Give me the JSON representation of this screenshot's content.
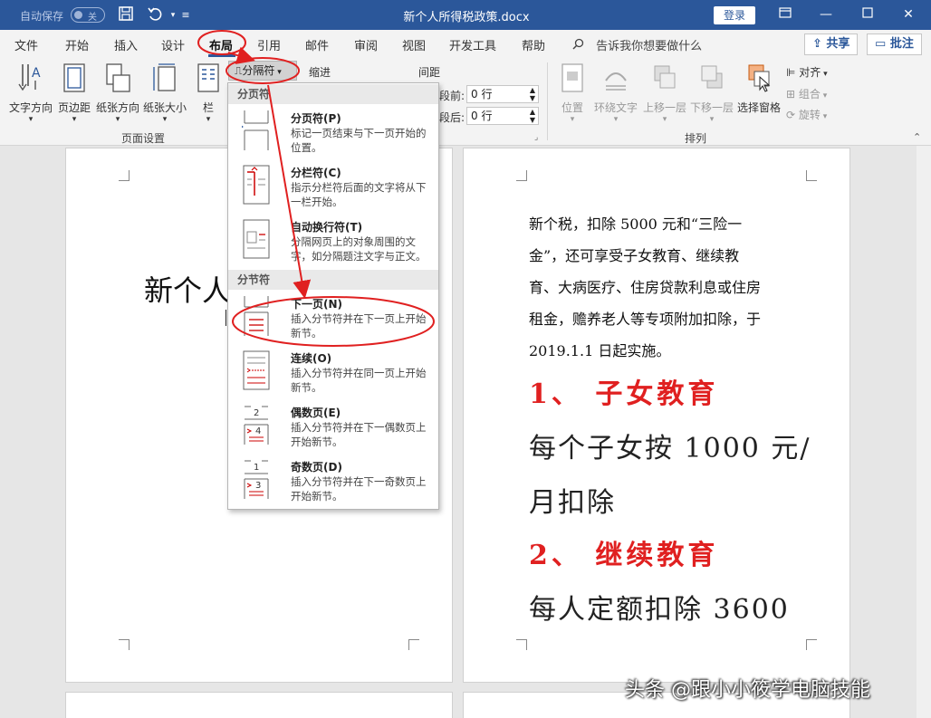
{
  "titlebar": {
    "autosave_label": "自动保存",
    "autosave_state": "关",
    "doc_title": "新个人所得税政策.docx",
    "login_label": "登录"
  },
  "tabs": [
    {
      "label": "文件",
      "active": false
    },
    {
      "label": "开始",
      "active": false
    },
    {
      "label": "插入",
      "active": false
    },
    {
      "label": "设计",
      "active": false
    },
    {
      "label": "布局",
      "active": true
    },
    {
      "label": "引用",
      "active": false
    },
    {
      "label": "邮件",
      "active": false
    },
    {
      "label": "审阅",
      "active": false
    },
    {
      "label": "视图",
      "active": false
    },
    {
      "label": "开发工具",
      "active": false
    },
    {
      "label": "帮助",
      "active": false
    }
  ],
  "tell_me": "告诉我你想要做什么",
  "share_label": "共享",
  "comment_label": "批注",
  "ribbon": {
    "page_setup": {
      "text_direction": "文字方向",
      "margins": "页边距",
      "orientation": "纸张方向",
      "size": "纸张大小",
      "columns": "栏",
      "breaks": "分隔符",
      "group_label": "页面设置"
    },
    "indent_label": "缩进",
    "spacing_label": "间距",
    "spacing_before_label": "段前:",
    "spacing_before_value": "0 行",
    "spacing_after_label": "段后:",
    "spacing_after_value": "0 行",
    "arrange": {
      "position": "位置",
      "wrap_text": "环绕文字",
      "bring_forward": "上移一层",
      "send_backward": "下移一层",
      "selection_pane": "选择窗格",
      "align": "对齐",
      "group": "组合",
      "rotate": "旋转",
      "group_label": "排列"
    }
  },
  "breaks_menu": {
    "page_breaks_header": "分页符",
    "section_breaks_header": "分节符",
    "items": [
      {
        "title": "分页符(P)",
        "desc": "标记一页结束与下一页开始的位置。"
      },
      {
        "title": "分栏符(C)",
        "desc": "指示分栏符后面的文字将从下一栏开始。"
      },
      {
        "title": "自动换行符(T)",
        "desc": "分隔网页上的对象周围的文字，如分隔题注文字与正文。"
      },
      {
        "title": "下一页(N)",
        "desc": "插入分节符并在下一页上开始新节。"
      },
      {
        "title": "连续(O)",
        "desc": "插入分节符并在同一页上开始新节。"
      },
      {
        "title": "偶数页(E)",
        "desc": "插入分节符并在下一偶数页上开始新节。"
      },
      {
        "title": "奇数页(D)",
        "desc": "插入分节符并在下一奇数页上开始新节。"
      }
    ]
  },
  "document": {
    "left_title_fragment": "新个人",
    "paragraph_lines": [
      "新个税，扣除 5000 元和“三险一",
      "金”，还可享受子女教育、继续教",
      "育、大病医疗、住房贷款利息或住房",
      "租金，赡养老人等专项附加扣除，于",
      "2019.1.1 日起实施。"
    ],
    "heading1": "1、 子女教育",
    "line1a": "每个子女按 1000 元/",
    "line1b": "月扣除",
    "heading2": "2、 继续教育",
    "line2": "每人定额扣除 3600"
  },
  "watermark": "头条 @跟小小筱学电脑技能",
  "colors": {
    "titlebar": "#2b579a",
    "annotation_red": "#e02020",
    "heading_red": "#e02020"
  }
}
